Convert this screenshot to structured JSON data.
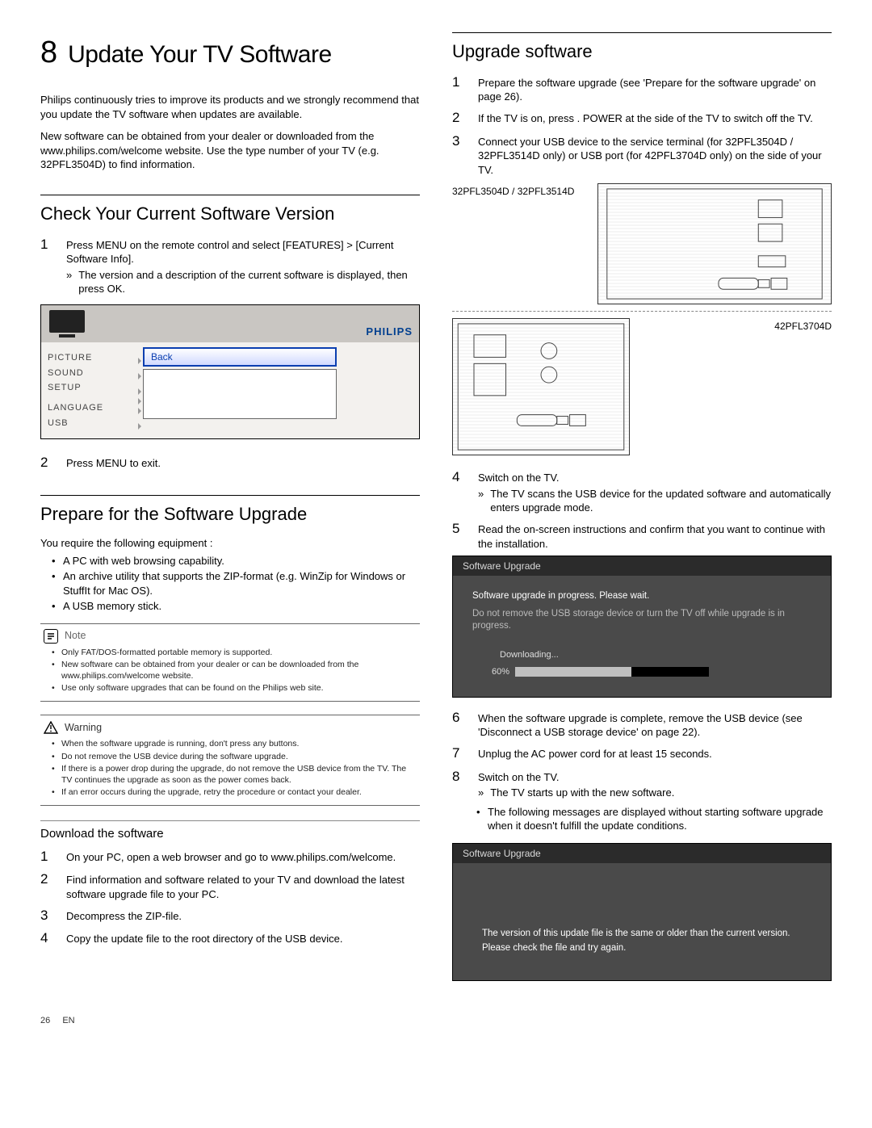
{
  "chapter": {
    "number": "8",
    "title": "Update Your TV Software"
  },
  "intro": {
    "p1": "Philips continuously tries to improve its products and we strongly recommend that you update the TV software when updates are available.",
    "p2": "New software can be obtained from your dealer or downloaded from the www.philips.com/welcome website. Use the type number of your TV (e.g. 32PFL3504D) to ﬁnd information."
  },
  "check": {
    "heading": "Check Your Current Software Version",
    "step1": "Press MENU on the remote control and select [FEATURES] > [Current Software Info].",
    "step1_sub": "The version and a description of the current software is displayed, then press OK.",
    "step2": "Press MENU to exit."
  },
  "tvmenu": {
    "brand": "PHILIPS",
    "items": [
      "PICTURE",
      "SOUND",
      "SETUP",
      "LANGUAGE",
      "USB"
    ],
    "back": "Back"
  },
  "prepare": {
    "heading": "Prepare for the Software Upgrade",
    "lead": "You require the following equipment :",
    "b1": "A PC with web browsing capability.",
    "b2": "An archive utility that supports the ZIP-format (e.g. WinZip for Windows or StuffIt for Mac OS).",
    "b3": "A USB memory stick."
  },
  "note": {
    "label": "Note",
    "n1": "Only FAT/DOS-formatted portable memory is supported.",
    "n2": "New software can be obtained from your dealer or can be downloaded from the www.philips.com/welcome website.",
    "n3": "Use only software upgrades that can be found on the Philips web site."
  },
  "warning": {
    "label": "Warning",
    "w1": "When the software upgrade is running, don't press any buttons.",
    "w2": "Do not remove the USB device during the software upgrade.",
    "w3": "If there is a power drop during the upgrade, do not remove the USB device from the TV. The TV continues the upgrade as soon as the power comes back.",
    "w4": "If an error occurs during the upgrade, retry the procedure or contact your dealer."
  },
  "download": {
    "heading": "Download the software",
    "s1": "On your PC, open a web browser and go to www.philips.com/welcome.",
    "s2": "Find information and software related to your TV and download the latest software upgrade ﬁle to your PC.",
    "s3": "Decompress the ZIP-ﬁle.",
    "s4": "Copy the update ﬁle to the root directory of the USB device."
  },
  "upgrade": {
    "heading": "Upgrade software",
    "s1": "Prepare the software upgrade (see 'Prepare for the software upgrade' on page 26).",
    "s2": "If the TV is on, press . POWER at the side of the TV to switch off the TV.",
    "s3": "Connect your USB device to the service terminal (for 32PFL3504D / 32PFL3514D only) or USB port (for 42PFL3704D only) on the side of your TV.",
    "panel1_label": "32PFL3504D / 32PFL3514D",
    "panel2_label": "42PFL3704D",
    "s4": "Switch on the TV.",
    "s4_sub": "The TV scans the USB device for the updated software and automatically enters upgrade mode.",
    "s5": "Read the on-screen instructions and conﬁrm that you want to continue with the installation.",
    "s6": "When the software upgrade is complete, remove the USB device (see 'Disconnect a USB storage device' on page 22).",
    "s7": "Unplug the AC power cord for at least 15 seconds.",
    "s8": "Switch on the TV.",
    "s8_sub": "The TV starts up with the new software.",
    "after_bullet": "The following messages are displayed without starting software upgrade when it doesn't fulﬁll the update conditions."
  },
  "osd1": {
    "title": "Software Upgrade",
    "line1": "Software upgrade in progress. Please wait.",
    "line2": "Do not remove the USB storage device or turn the TV off while upgrade is in progress.",
    "downloading": "Downloading...",
    "pct": "60%"
  },
  "osd2": {
    "title": "Software Upgrade",
    "line1": "The version of this update file is the same or older than the current version.",
    "line2": "Please check the file and try again."
  },
  "footer": {
    "page": "26",
    "lang": "EN"
  }
}
